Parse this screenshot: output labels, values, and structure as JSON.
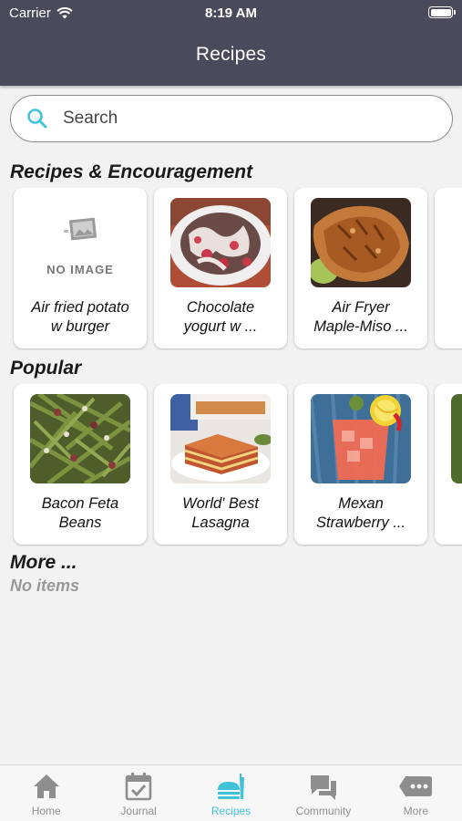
{
  "status_bar": {
    "carrier": "Carrier",
    "time": "8:19 AM"
  },
  "nav": {
    "title": "Recipes"
  },
  "search": {
    "placeholder": "Search"
  },
  "sections": {
    "encouragement": {
      "title": "Recipes & Encouragement",
      "cards": [
        {
          "line1": "Air fried potato",
          "line2": "w burger",
          "image": "no-image",
          "no_image_text": "NO IMAGE"
        },
        {
          "line1": "Chocolate",
          "line2": "yogurt w ...",
          "image": "chocolate-yogurt-photo"
        },
        {
          "line1": "Air Fryer",
          "line2": "Maple-Miso ...",
          "image": "maple-miso-salmon-photo"
        }
      ]
    },
    "popular": {
      "title": "Popular",
      "cards": [
        {
          "line1": "Bacon Feta",
          "line2": "Beans",
          "image": "bacon-feta-beans-photo"
        },
        {
          "line1": "World' Best",
          "line2": "Lasagna",
          "image": "lasagna-photo"
        },
        {
          "line1": "Mexan",
          "line2": "Strawberry ...",
          "image": "strawberry-drink-photo"
        }
      ]
    },
    "more": {
      "title": "More ...",
      "empty_text": "No items"
    }
  },
  "tabbar": {
    "active": "Recipes",
    "tabs": [
      {
        "label": "Home",
        "icon": "home-icon"
      },
      {
        "label": "Journal",
        "icon": "journal-icon"
      },
      {
        "label": "Recipes",
        "icon": "recipes-icon"
      },
      {
        "label": "Community",
        "icon": "community-icon"
      },
      {
        "label": "More",
        "icon": "more-icon"
      }
    ]
  },
  "colors": {
    "header": "#4a4a5c",
    "accent": "#41c2d9",
    "background": "#f2f2f2"
  }
}
